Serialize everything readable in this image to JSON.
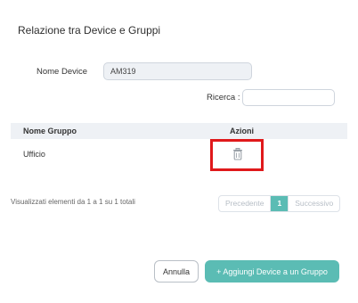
{
  "modal": {
    "title": "Relazione tra Device e Gruppi"
  },
  "device": {
    "label": "Nome Device",
    "value": "AM319"
  },
  "search": {
    "label": "Ricerca :",
    "value": ""
  },
  "table": {
    "headers": {
      "group": "Nome Gruppo",
      "actions": "Azioni"
    },
    "rows": [
      {
        "group": "Ufficio",
        "action_icon": "trash-icon"
      }
    ]
  },
  "info": "Visualizzati elementi da 1 a 1 su 1 totali",
  "pagination": {
    "prev": "Precedente",
    "current": "1",
    "next": "Successivo"
  },
  "buttons": {
    "cancel": "Annulla",
    "add": "+ Aggiungi Device a un Gruppo"
  },
  "colors": {
    "accent": "#5bbcb4",
    "highlight": "#e0191b"
  }
}
